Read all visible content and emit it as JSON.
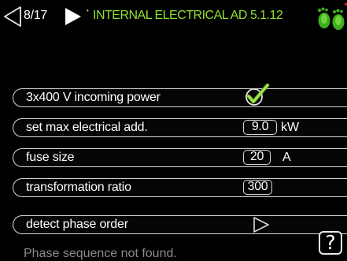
{
  "header": {
    "back_icon": "triangle-left-outline",
    "page_indicator": "8/17",
    "next_icon": "triangle-right-filled",
    "title": "INTERNAL ELECTRICAL AD 5.1.12",
    "logo_icon": "green-footprints-icon",
    "accent_color": "#8fe030"
  },
  "rows": {
    "incoming_power": {
      "label": "3x400 V incoming power",
      "checked": true,
      "check_icon": "green-checkmark-icon"
    },
    "max_electrical_add": {
      "label": "set max electrical add.",
      "value": "9.0",
      "unit": "kW"
    },
    "fuse_size": {
      "label": "fuse size",
      "value": "20",
      "unit": "A"
    },
    "transformation_ratio": {
      "label": "transformation ratio",
      "value": "300"
    },
    "detect_phase_order": {
      "label": "detect phase order",
      "arrow_icon": "arrow-right-outline-icon"
    }
  },
  "status": {
    "message": "Phase sequence not found."
  },
  "help": {
    "label": "?"
  }
}
